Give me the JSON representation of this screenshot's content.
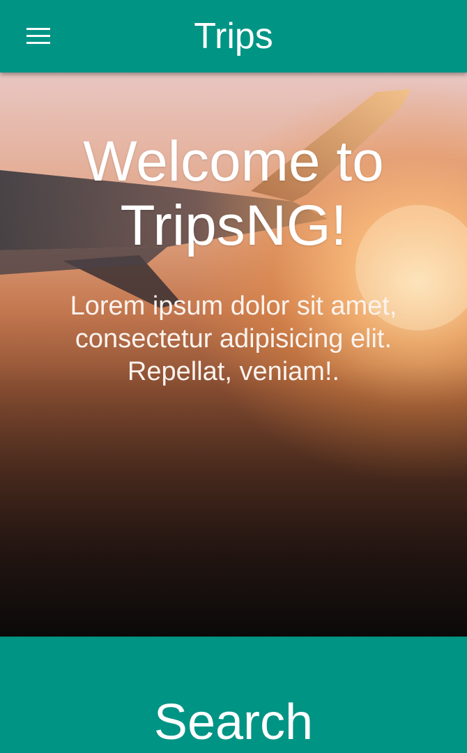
{
  "appbar": {
    "title": "Trips",
    "menu_icon": "hamburger-menu-icon"
  },
  "hero": {
    "title": "Welcome to TripsNG!",
    "text": "Lorem ipsum dolor sit amet, consectetur adipisicing elit. Repellat, veniam!."
  },
  "search_section": {
    "heading": "Search"
  },
  "colors": {
    "primary": "#009485",
    "text_on_primary": "#ffffff"
  }
}
